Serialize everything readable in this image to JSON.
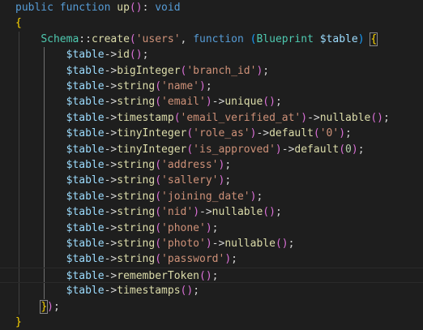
{
  "editor": {
    "colors": {
      "background": "#1e1e1e",
      "keyword": "#569cd6",
      "function": "#dcdcaa",
      "class": "#4ec9b0",
      "variable": "#9cdcfe",
      "string": "#ce9178",
      "number": "#b5cea8",
      "bracket_level1": "#ffd700",
      "bracket_level2": "#da70d6",
      "bracket_level3": "#179fff"
    },
    "lines": [
      [
        {
          "t": "public",
          "c": "kw"
        },
        {
          "t": " "
        },
        {
          "t": "function",
          "c": "kw"
        },
        {
          "t": " "
        },
        {
          "t": "up",
          "c": "fn"
        },
        {
          "t": "()",
          "c": "p2"
        },
        {
          "t": ": "
        },
        {
          "t": "void",
          "c": "kw"
        }
      ],
      [
        {
          "t": "{",
          "c": "p1"
        }
      ],
      [
        {
          "t": "    "
        },
        {
          "t": "Schema",
          "c": "cls"
        },
        {
          "t": "::"
        },
        {
          "t": "create",
          "c": "fn"
        },
        {
          "t": "(",
          "c": "p2"
        },
        {
          "t": "'users'",
          "c": "str"
        },
        {
          "t": ", "
        },
        {
          "t": "function",
          "c": "kw"
        },
        {
          "t": " "
        },
        {
          "t": "(",
          "c": "p3"
        },
        {
          "t": "Blueprint",
          "c": "cls"
        },
        {
          "t": " "
        },
        {
          "t": "$table",
          "c": "var"
        },
        {
          "t": ")",
          "c": "p3"
        },
        {
          "t": " "
        },
        {
          "t": "{",
          "c": "p1",
          "hl": true
        }
      ],
      [
        {
          "t": "        "
        },
        {
          "t": "$table",
          "c": "var"
        },
        {
          "t": "->"
        },
        {
          "t": "id",
          "c": "fn"
        },
        {
          "t": "()",
          "c": "p2"
        },
        {
          "t": ";"
        }
      ],
      [
        {
          "t": "        "
        },
        {
          "t": "$table",
          "c": "var"
        },
        {
          "t": "->"
        },
        {
          "t": "bigInteger",
          "c": "fn"
        },
        {
          "t": "(",
          "c": "p2"
        },
        {
          "t": "'branch_id'",
          "c": "str"
        },
        {
          "t": ")",
          "c": "p2"
        },
        {
          "t": ";"
        }
      ],
      [
        {
          "t": "        "
        },
        {
          "t": "$table",
          "c": "var"
        },
        {
          "t": "->"
        },
        {
          "t": "string",
          "c": "fn"
        },
        {
          "t": "(",
          "c": "p2"
        },
        {
          "t": "'name'",
          "c": "str"
        },
        {
          "t": ")",
          "c": "p2"
        },
        {
          "t": ";"
        }
      ],
      [
        {
          "t": "        "
        },
        {
          "t": "$table",
          "c": "var"
        },
        {
          "t": "->"
        },
        {
          "t": "string",
          "c": "fn"
        },
        {
          "t": "(",
          "c": "p2"
        },
        {
          "t": "'email'",
          "c": "str"
        },
        {
          "t": ")",
          "c": "p2"
        },
        {
          "t": "->"
        },
        {
          "t": "unique",
          "c": "fn"
        },
        {
          "t": "()",
          "c": "p2"
        },
        {
          "t": ";"
        }
      ],
      [
        {
          "t": "        "
        },
        {
          "t": "$table",
          "c": "var"
        },
        {
          "t": "->"
        },
        {
          "t": "timestamp",
          "c": "fn"
        },
        {
          "t": "(",
          "c": "p2"
        },
        {
          "t": "'email_verified_at'",
          "c": "str"
        },
        {
          "t": ")",
          "c": "p2"
        },
        {
          "t": "->"
        },
        {
          "t": "nullable",
          "c": "fn"
        },
        {
          "t": "()",
          "c": "p2"
        },
        {
          "t": ";"
        }
      ],
      [
        {
          "t": "        "
        },
        {
          "t": "$table",
          "c": "var"
        },
        {
          "t": "->"
        },
        {
          "t": "tinyInteger",
          "c": "fn"
        },
        {
          "t": "(",
          "c": "p2"
        },
        {
          "t": "'role_as'",
          "c": "str"
        },
        {
          "t": ")",
          "c": "p2"
        },
        {
          "t": "->"
        },
        {
          "t": "default",
          "c": "fn"
        },
        {
          "t": "(",
          "c": "p2"
        },
        {
          "t": "'0'",
          "c": "str"
        },
        {
          "t": ")",
          "c": "p2"
        },
        {
          "t": ";"
        }
      ],
      [
        {
          "t": "        "
        },
        {
          "t": "$table",
          "c": "var"
        },
        {
          "t": "->"
        },
        {
          "t": "tinyInteger",
          "c": "fn"
        },
        {
          "t": "(",
          "c": "p2"
        },
        {
          "t": "'is_approved'",
          "c": "str"
        },
        {
          "t": ")",
          "c": "p2"
        },
        {
          "t": "->"
        },
        {
          "t": "default",
          "c": "fn"
        },
        {
          "t": "(",
          "c": "p2"
        },
        {
          "t": "0",
          "c": "num"
        },
        {
          "t": ")",
          "c": "p2"
        },
        {
          "t": ";"
        }
      ],
      [
        {
          "t": "        "
        },
        {
          "t": "$table",
          "c": "var"
        },
        {
          "t": "->"
        },
        {
          "t": "string",
          "c": "fn"
        },
        {
          "t": "(",
          "c": "p2"
        },
        {
          "t": "'address'",
          "c": "str"
        },
        {
          "t": ")",
          "c": "p2"
        },
        {
          "t": ";"
        }
      ],
      [
        {
          "t": "        "
        },
        {
          "t": "$table",
          "c": "var"
        },
        {
          "t": "->"
        },
        {
          "t": "string",
          "c": "fn"
        },
        {
          "t": "(",
          "c": "p2"
        },
        {
          "t": "'sallery'",
          "c": "str"
        },
        {
          "t": ")",
          "c": "p2"
        },
        {
          "t": ";"
        }
      ],
      [
        {
          "t": "        "
        },
        {
          "t": "$table",
          "c": "var"
        },
        {
          "t": "->"
        },
        {
          "t": "string",
          "c": "fn"
        },
        {
          "t": "(",
          "c": "p2"
        },
        {
          "t": "'joining_date'",
          "c": "str"
        },
        {
          "t": ")",
          "c": "p2"
        },
        {
          "t": ";"
        }
      ],
      [
        {
          "t": "        "
        },
        {
          "t": "$table",
          "c": "var"
        },
        {
          "t": "->"
        },
        {
          "t": "string",
          "c": "fn"
        },
        {
          "t": "(",
          "c": "p2"
        },
        {
          "t": "'nid'",
          "c": "str"
        },
        {
          "t": ")",
          "c": "p2"
        },
        {
          "t": "->"
        },
        {
          "t": "nullable",
          "c": "fn"
        },
        {
          "t": "()",
          "c": "p2"
        },
        {
          "t": ";"
        }
      ],
      [
        {
          "t": "        "
        },
        {
          "t": "$table",
          "c": "var"
        },
        {
          "t": "->"
        },
        {
          "t": "string",
          "c": "fn"
        },
        {
          "t": "(",
          "c": "p2"
        },
        {
          "t": "'phone'",
          "c": "str"
        },
        {
          "t": ")",
          "c": "p2"
        },
        {
          "t": ";"
        }
      ],
      [
        {
          "t": "        "
        },
        {
          "t": "$table",
          "c": "var"
        },
        {
          "t": "->"
        },
        {
          "t": "string",
          "c": "fn"
        },
        {
          "t": "(",
          "c": "p2"
        },
        {
          "t": "'photo'",
          "c": "str"
        },
        {
          "t": ")",
          "c": "p2"
        },
        {
          "t": "->"
        },
        {
          "t": "nullable",
          "c": "fn"
        },
        {
          "t": "()",
          "c": "p2"
        },
        {
          "t": ";"
        }
      ],
      [
        {
          "t": "        "
        },
        {
          "t": "$table",
          "c": "var"
        },
        {
          "t": "->"
        },
        {
          "t": "string",
          "c": "fn"
        },
        {
          "t": "(",
          "c": "p2"
        },
        {
          "t": "'password'",
          "c": "str"
        },
        {
          "t": ")",
          "c": "p2"
        },
        {
          "t": ";"
        }
      ],
      [
        {
          "t": "        "
        },
        {
          "t": "$table",
          "c": "var"
        },
        {
          "t": "->"
        },
        {
          "t": "rememberToken",
          "c": "fn"
        },
        {
          "t": "()",
          "c": "p2"
        },
        {
          "t": ";"
        }
      ],
      [
        {
          "t": "        "
        },
        {
          "t": "$table",
          "c": "var"
        },
        {
          "t": "->"
        },
        {
          "t": "timestamps",
          "c": "fn"
        },
        {
          "t": "()",
          "c": "p2"
        },
        {
          "t": ";"
        }
      ],
      [
        {
          "t": "    "
        },
        {
          "t": "}",
          "c": "p1",
          "hl": true
        },
        {
          "t": ")",
          "c": "p2"
        },
        {
          "t": ";"
        }
      ],
      [
        {
          "t": "}",
          "c": "p1"
        }
      ]
    ]
  }
}
